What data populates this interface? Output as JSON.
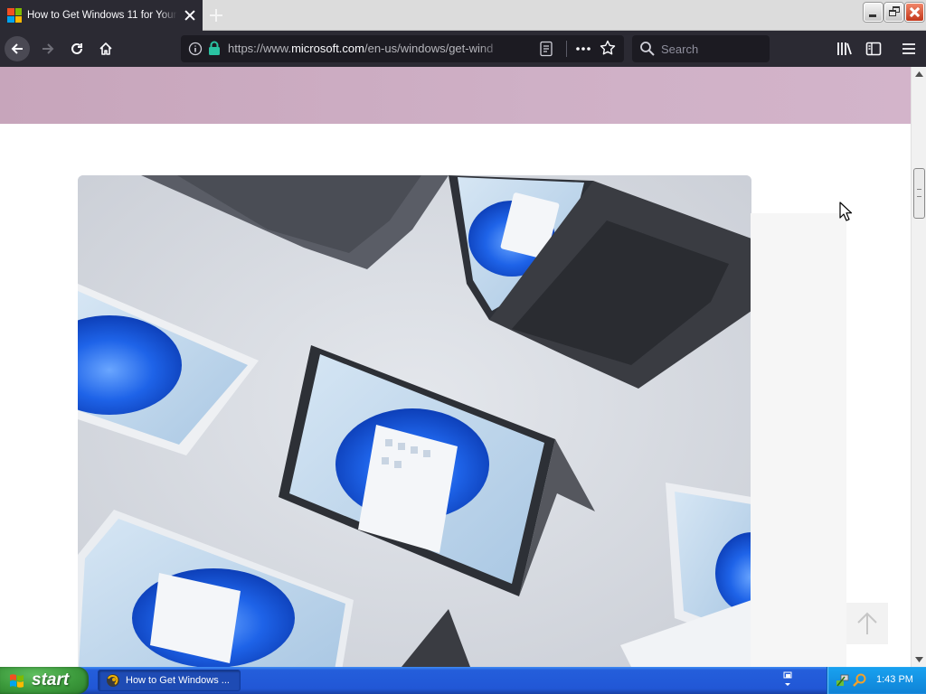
{
  "browser": {
    "tab": {
      "title": "How to Get Windows 11 for Your C",
      "favicon_colors": [
        "#f25022",
        "#7fba00",
        "#00a4ef",
        "#ffb900"
      ]
    },
    "window_buttons": [
      "minimize",
      "restore",
      "close"
    ],
    "toolbar": {
      "back_icon": "arrow-left-icon",
      "forward_icon": "arrow-right-icon",
      "reload_icon": "reload-icon",
      "home_icon": "home-icon",
      "url_prefix": "https://www.",
      "url_domain": "microsoft.com",
      "url_path": "/en-us/windows/get-wind",
      "search_placeholder": "Search"
    }
  },
  "page": {
    "banner_color": "#cfb0c6",
    "hero_image": "windows-11-laptops-photo",
    "back_to_top_icon": "arrow-up-icon"
  },
  "taskbar": {
    "start_label": "start",
    "window_item": "How to Get Windows ...",
    "clock": "1:43 PM"
  },
  "colors": {
    "browser_chrome": "#2b2a33",
    "url_field": "#1c1b22",
    "secure_lock": "#2ac3a2",
    "taskbar_blue": "#245edb",
    "start_green": "#3c9a3c"
  }
}
